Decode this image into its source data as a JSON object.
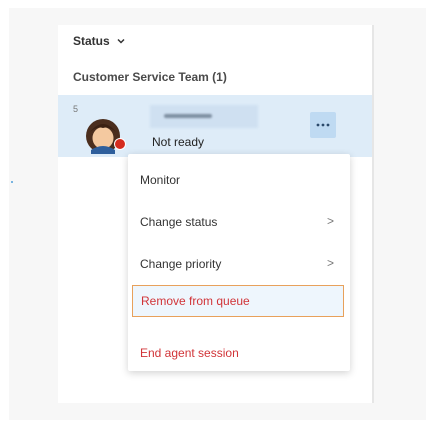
{
  "filter": {
    "label": "Status"
  },
  "queue": {
    "group_label": "Customer Service Team (1)"
  },
  "agent": {
    "priority": "5",
    "status": "Not ready",
    "status_color": "#d52b1e"
  },
  "menu": {
    "items": [
      {
        "label": "Monitor",
        "has_submenu": false
      },
      {
        "label": "Change status",
        "has_submenu": true
      },
      {
        "label": "Change priority",
        "has_submenu": true
      },
      {
        "label": "Remove from queue",
        "has_submenu": false,
        "highlighted": true
      },
      {
        "label": "End agent session",
        "has_submenu": false
      }
    ],
    "submenu_arrow": ">",
    "danger_color": "#d13438",
    "highlight_border_color": "#e8a15b"
  },
  "icons": {
    "filter": "chevron-down-icon",
    "more": "more-horizontal-icon",
    "avatar": "agent-avatar-icon"
  },
  "colors": {
    "selected_row": "#deecf8",
    "more_button": "#bfdaf2"
  }
}
